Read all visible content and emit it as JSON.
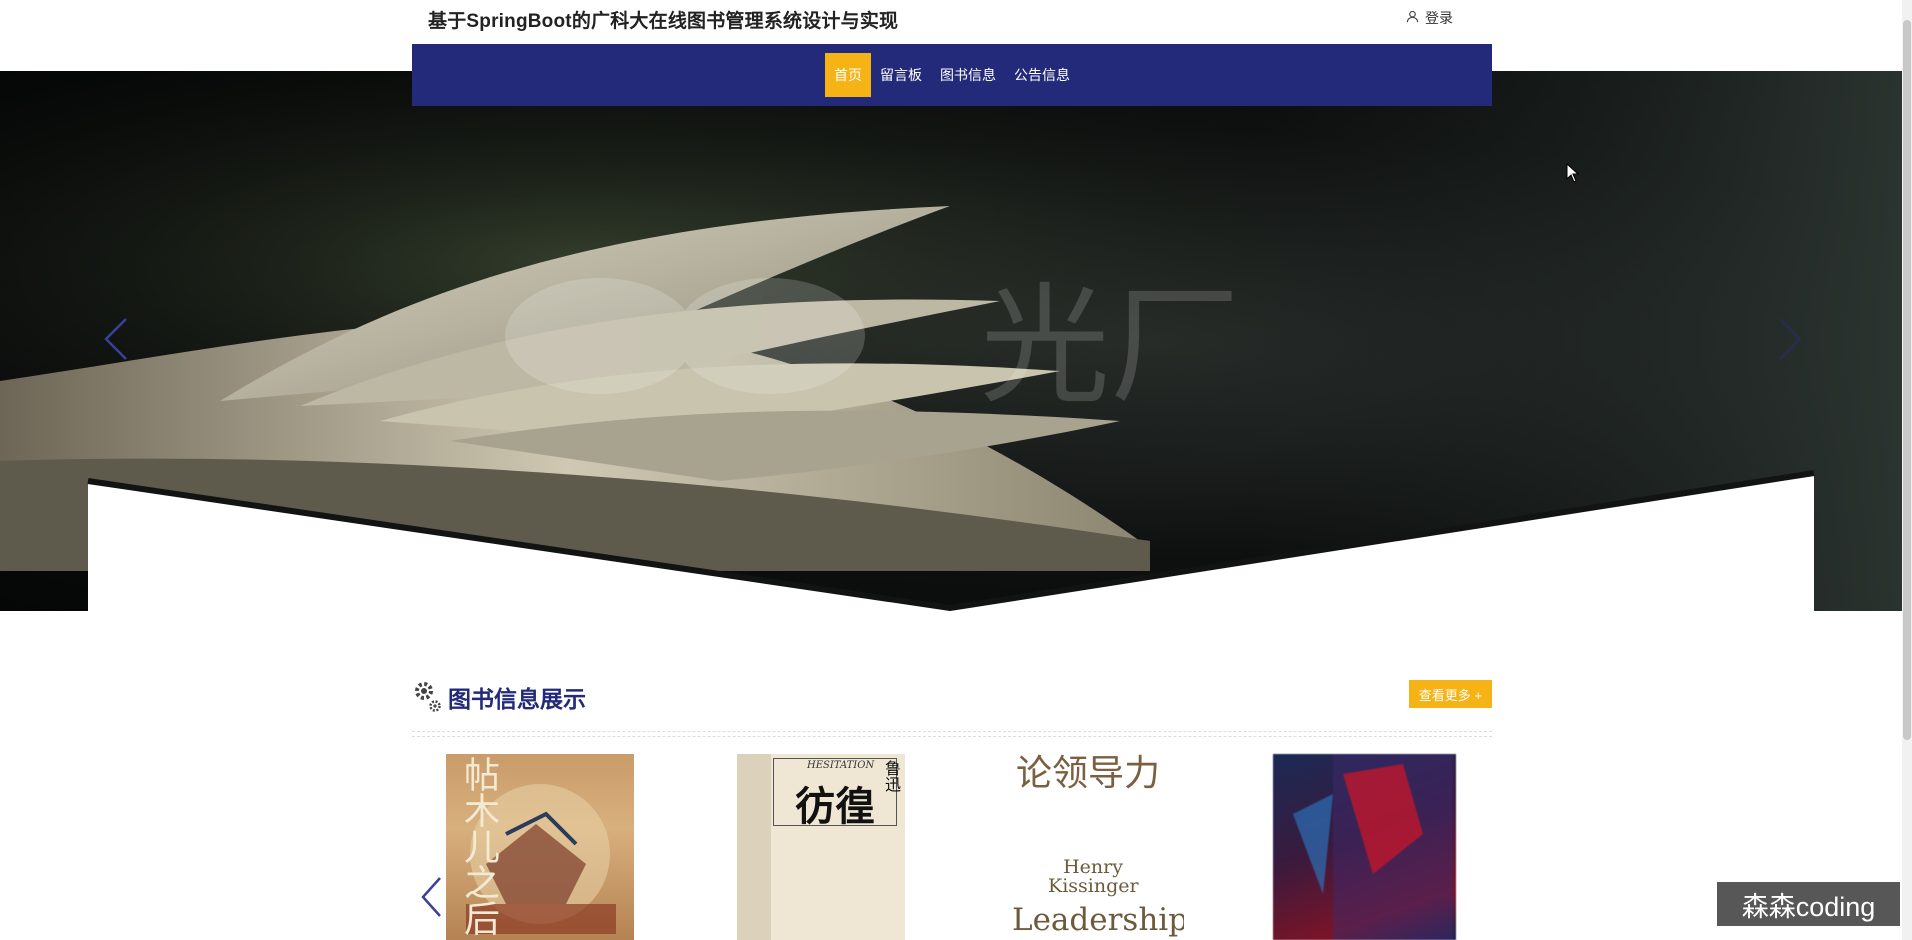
{
  "header": {
    "site_title": "基于SpringBoot的广科大在线图书管理系统设计与实现",
    "login_label": "登录"
  },
  "nav": {
    "items": [
      {
        "label": "首页",
        "active": true
      },
      {
        "label": "留言板",
        "active": false
      },
      {
        "label": "图书信息",
        "active": false
      },
      {
        "label": "公告信息",
        "active": false
      }
    ]
  },
  "hero": {
    "watermark_text": "光厂"
  },
  "books_section": {
    "title": "图书信息展示",
    "more_label": "查看更多 +",
    "books": [
      {
        "cover_title": "帖木儿之后"
      },
      {
        "cover_title": "彷徨",
        "cover_subtitle": "HESITATION",
        "cover_author": "鲁迅"
      },
      {
        "cover_title": "论领导力",
        "cover_author": "Henry Kissinger",
        "cover_subtitle": "Leadership"
      },
      {
        "cover_title": ""
      }
    ]
  },
  "overlay": {
    "watermark": "森森coding"
  },
  "colors": {
    "nav_bg": "#232a7a",
    "accent": "#f5b316",
    "section_title": "#232a7a"
  }
}
